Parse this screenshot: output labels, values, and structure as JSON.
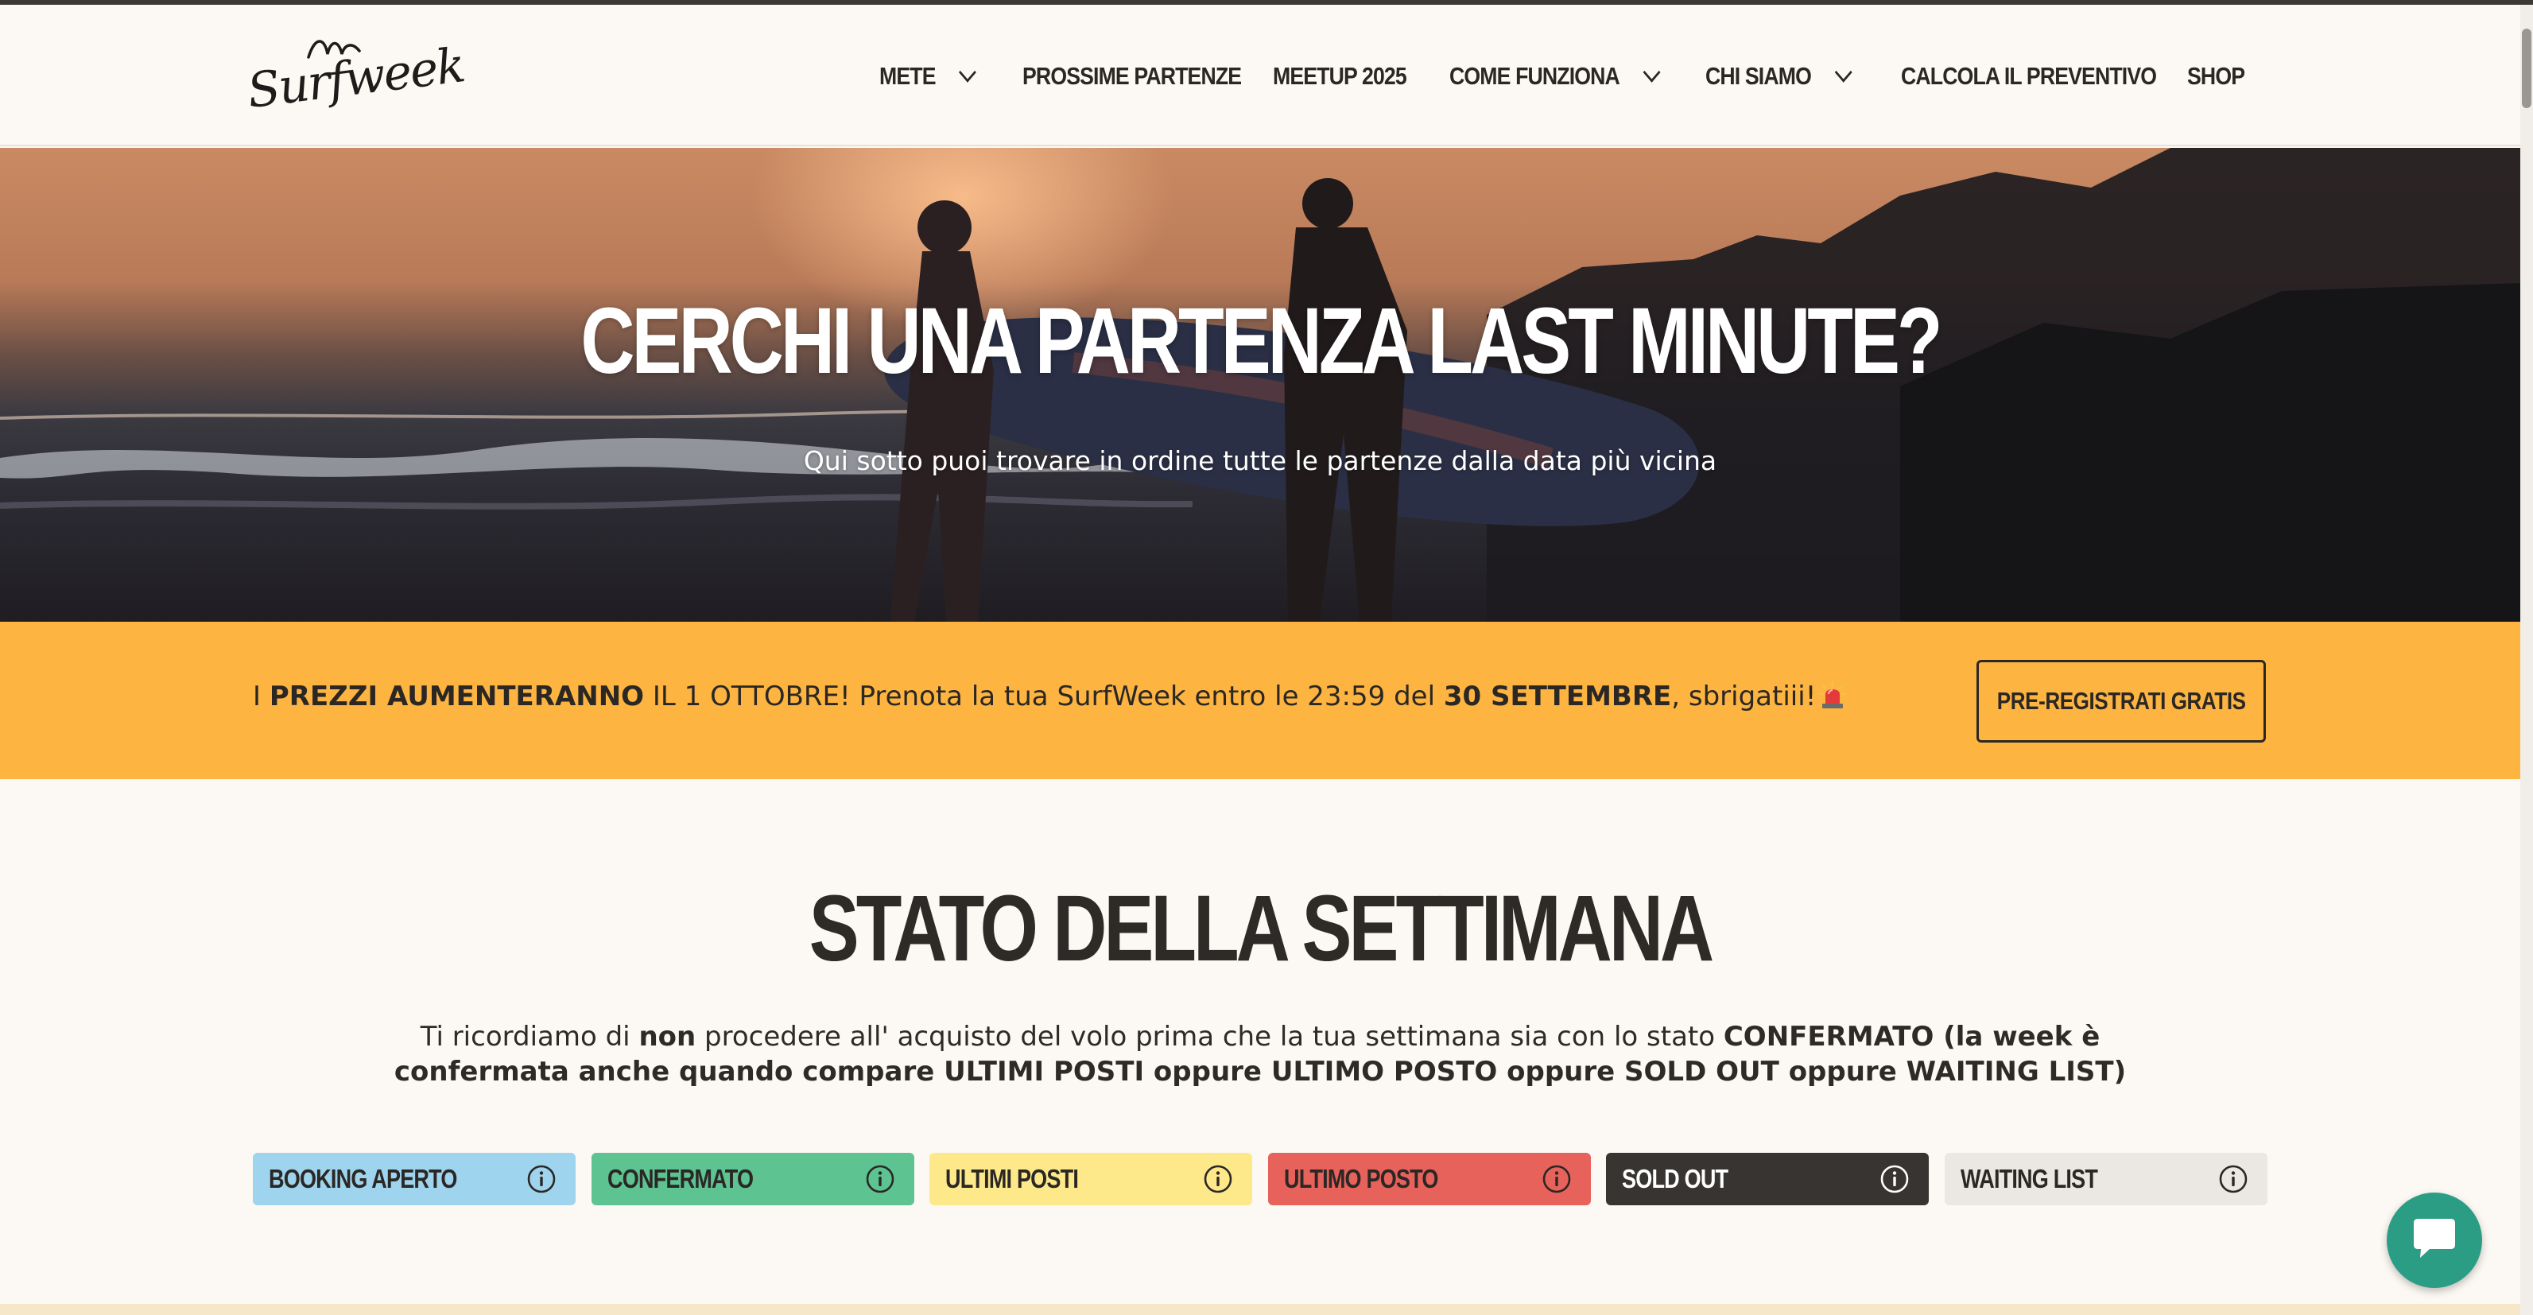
{
  "brand": {
    "logo_text": "Surfweek"
  },
  "nav": {
    "items": [
      {
        "label": "METE",
        "has_dropdown": true
      },
      {
        "label": "PROSSIME PARTENZE",
        "has_dropdown": false
      },
      {
        "label": "MEETUP 2025",
        "has_dropdown": false
      },
      {
        "label": "COME FUNZIONA",
        "has_dropdown": true
      },
      {
        "label": "CHI SIAMO",
        "has_dropdown": true
      },
      {
        "label": "CALCOLA IL PREVENTIVO",
        "has_dropdown": false
      },
      {
        "label": "SHOP",
        "has_dropdown": false
      }
    ]
  },
  "hero": {
    "title": "CERCHI UNA PARTENZA LAST MINUTE?",
    "subtitle": "Qui sotto puoi trovare in ordine tutte le partenze dalla data più vicina"
  },
  "promo": {
    "t1": "I ",
    "t2": "PREZZI AUMENTERANNO",
    "t3": " IL 1 OTTOBRE! Prenota la tua SurfWeek entro le 23:59 del ",
    "t4": "30 SETTEMBRE",
    "t5": ", sbrigatiii!",
    "button_label": "PRE-REGISTRATI GRATIS"
  },
  "status": {
    "title": "STATO DELLA SETTIMANA",
    "note_1": "Ti ricordiamo di ",
    "note_2": "non",
    "note_3": " procedere all' acquisto del volo prima che la tua settimana sia con lo stato ",
    "note_4": "CONFERMATO (la week è confermata anche quando compare ULTIMI POSTI oppure ULTIMO POSTO oppure SOLD OUT oppure WAITING LIST)",
    "badges": [
      {
        "label": "BOOKING APERTO",
        "bg": "#9fd4ee",
        "fg": "#2a2725"
      },
      {
        "label": "CONFERMATO",
        "bg": "#5cc391",
        "fg": "#2a2725"
      },
      {
        "label": "ULTIMI POSTI",
        "bg": "#fde98a",
        "fg": "#2a2725"
      },
      {
        "label": "ULTIMO POSTO",
        "bg": "#e8625c",
        "fg": "#2a2725"
      },
      {
        "label": "SOLD OUT",
        "bg": "#383431",
        "fg": "#ffffff"
      },
      {
        "label": "WAITING LIST",
        "bg": "#ebe8e4",
        "fg": "#2a2725"
      }
    ]
  },
  "colors": {
    "page_bg": "#fcf8f3",
    "promo_bg": "#fdb440",
    "chat_bg": "#2b9d84",
    "text": "#2e2a27"
  },
  "icons": {
    "dropdown": "chevron-down-icon",
    "info": "info-icon",
    "chat": "chat-bubble-icon",
    "siren": "siren-emoji-icon"
  }
}
